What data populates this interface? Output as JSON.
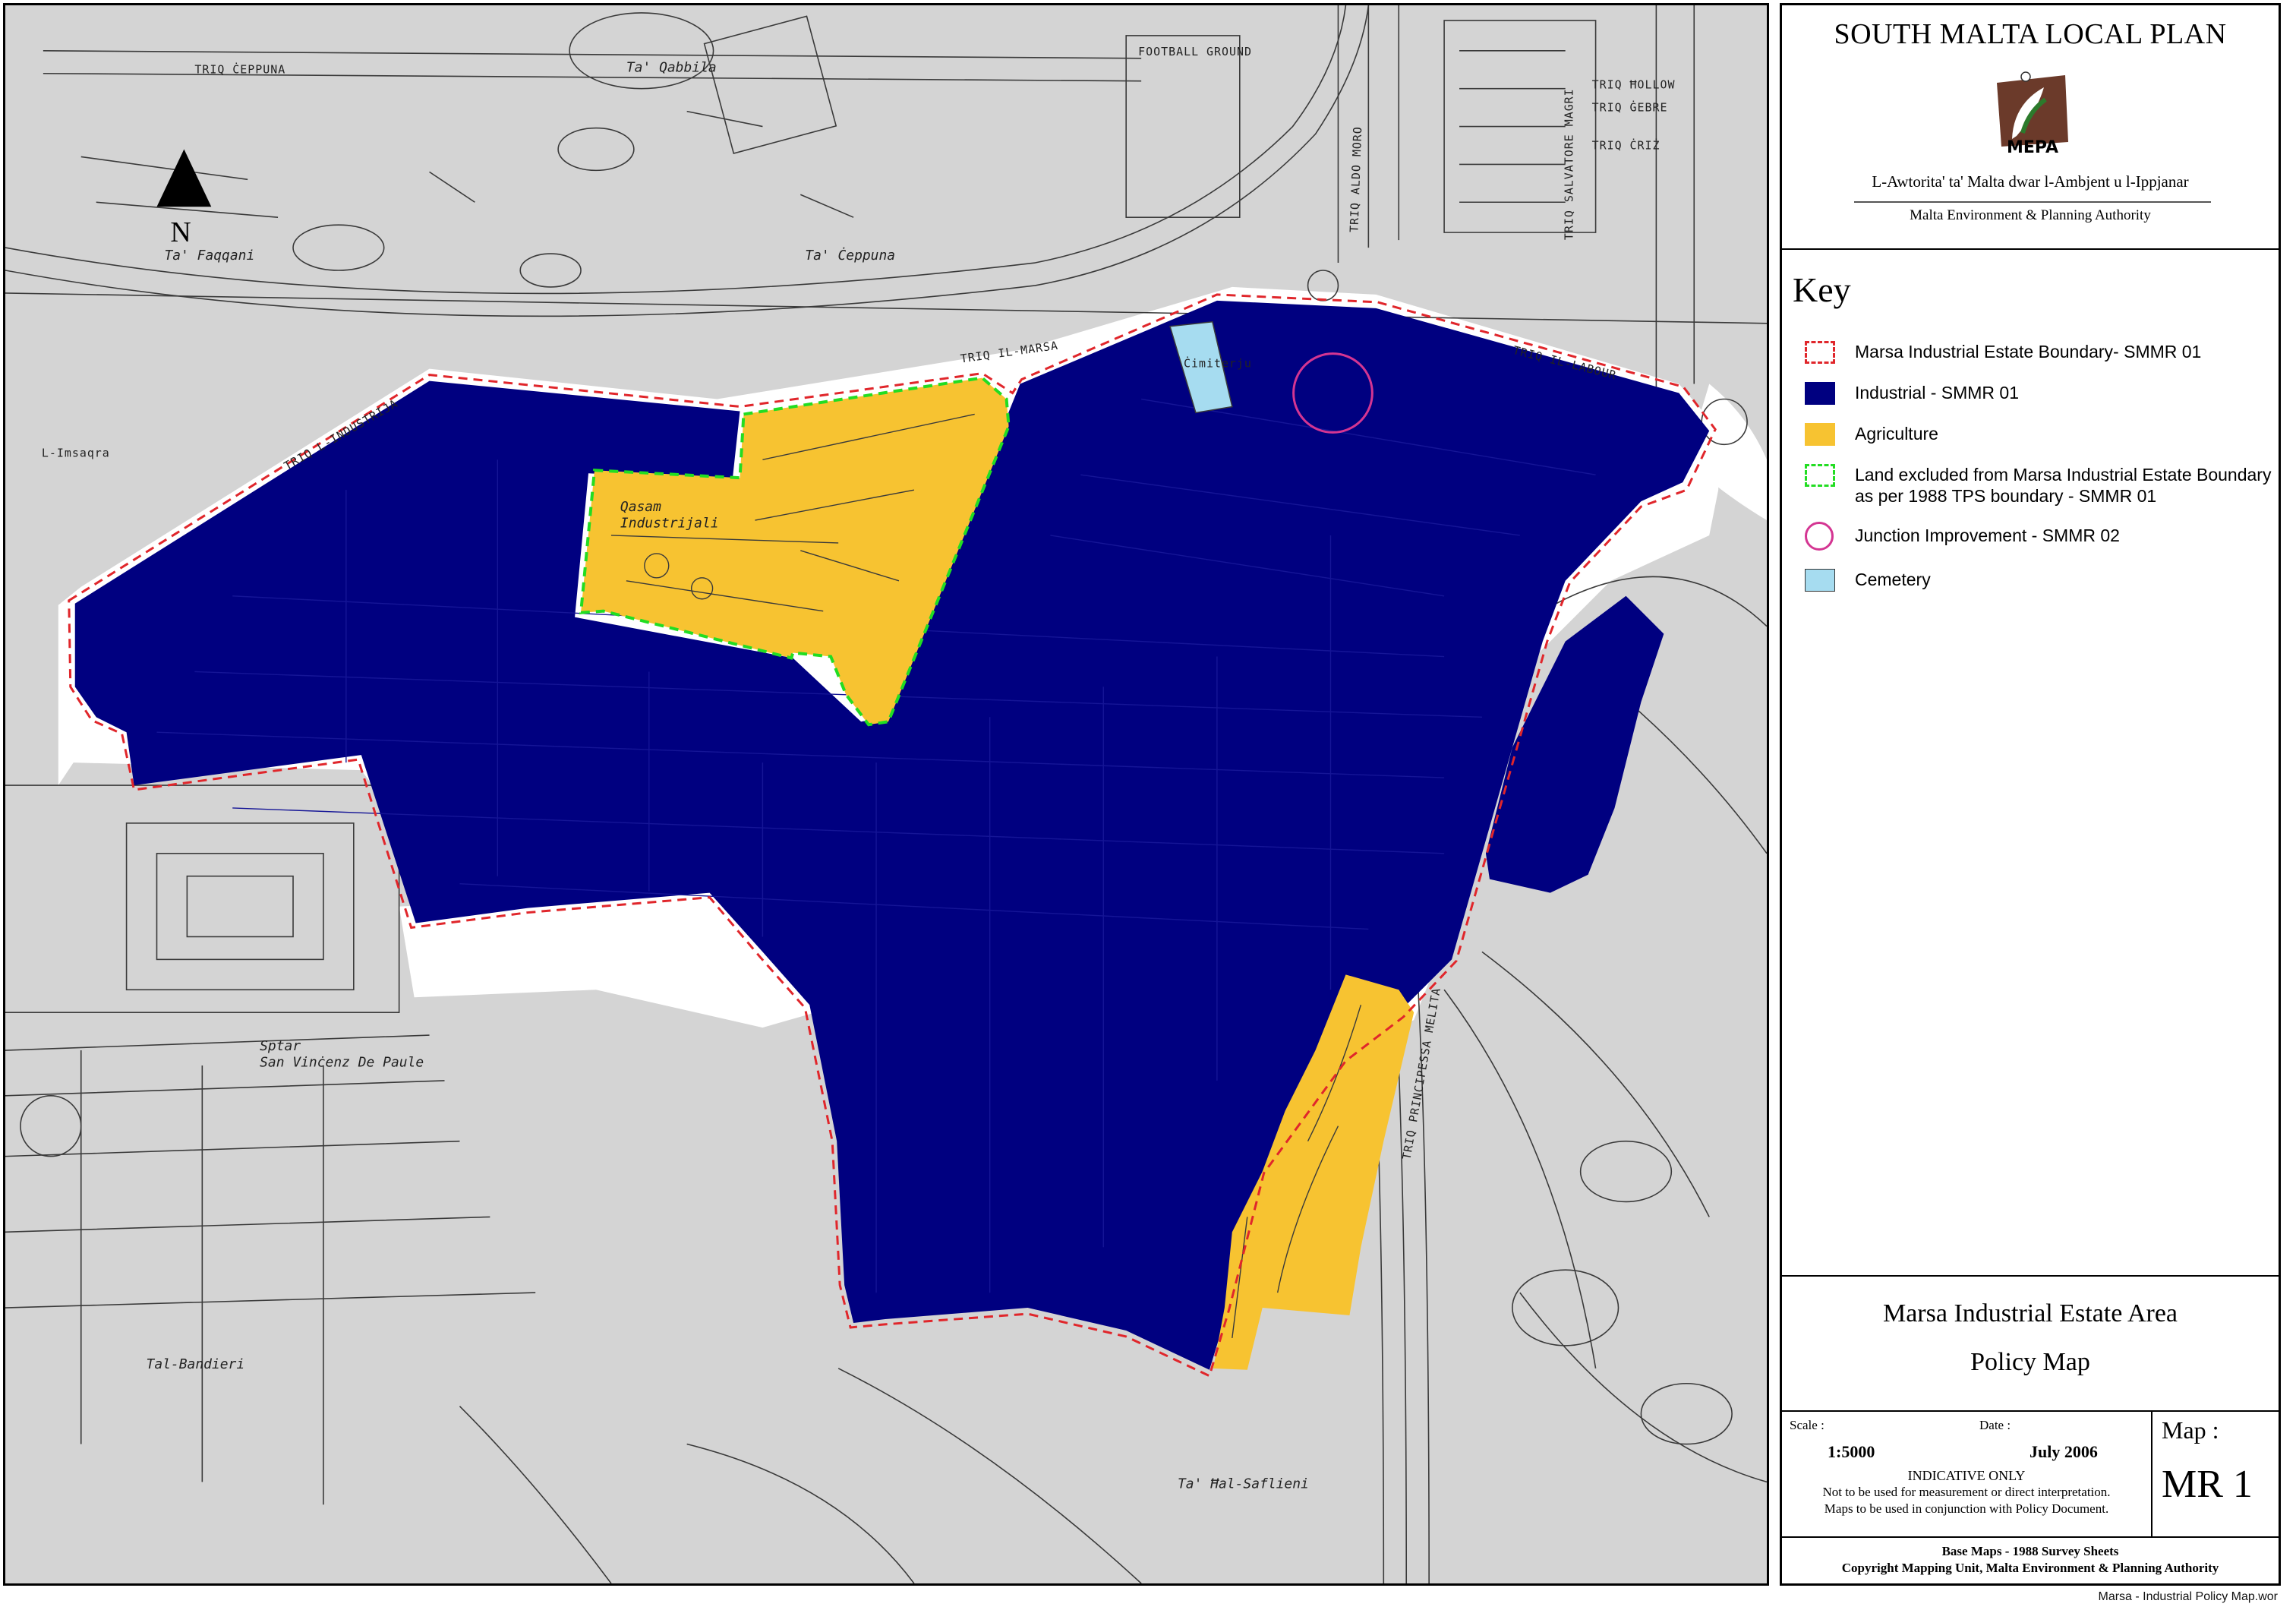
{
  "map": {
    "north_label": "N",
    "streets": [
      "TRIQ IL-MARSA",
      "TRIQ L-INDUSTRIJA",
      "TRIQ IL-LABOUR",
      "TRIQ ALDO MORO",
      "TRIQ PRINCIPESSA MELITA",
      "TRIQ ĊEPPUNA",
      "TRIQ SALVATORE MAGRI",
      "TRIQ ĠEBRE",
      "TRIQ ĊRIŻ",
      "TRIQ ĦOLLOW"
    ],
    "places": [
      "Ta' Qabbila",
      "Ta' Faqqani",
      "Ta' Ċeppuna",
      "Qasam\nIndustrijali",
      "Sptar\nSan Vinċenz De Paule",
      "Tal-Bandieri",
      "Ta' Ħal-Saflieni",
      "L-Imsaqra",
      "Ċimiterju",
      "FOOTBALL GROUND"
    ],
    "colors": {
      "background": "#d4d4d4",
      "industrial": "#000080",
      "agriculture": "#f7c331",
      "cemetery": "#a6dcf0",
      "boundary": "#e0262b",
      "excluded": "#22dd22",
      "junction": "#d43592",
      "lines": "#3a3a3a"
    }
  },
  "panel": {
    "plan_title": "SOUTH MALTA LOCAL PLAN",
    "logo_text": "MEPA",
    "authority_mt": "L-Awtorita' ta' Malta dwar l-Ambjent u l-Ippjanar",
    "authority_en": "Malta Environment & Planning Authority",
    "key_title": "Key",
    "key_items": [
      {
        "label": "Marsa Industrial Estate Boundary- SMMR 01",
        "swatch": "boundary-dashed-red"
      },
      {
        "label": "Industrial - SMMR 01",
        "swatch": "fill-navy"
      },
      {
        "label": "Agriculture",
        "swatch": "fill-yellow"
      },
      {
        "label": "Land excluded from Marsa Industrial Estate Boundary\nas per 1988 TPS boundary - SMMR 01",
        "swatch": "boundary-dashed-green"
      },
      {
        "label": "Junction Improvement - SMMR 02",
        "swatch": "circle-magenta"
      },
      {
        "label": "Cemetery",
        "swatch": "fill-lightblue"
      }
    ],
    "map_title_1": "Marsa Industrial Estate Area",
    "map_title_2": "Policy Map",
    "scale_caption": "Scale :",
    "scale_value": "1:5000",
    "date_caption": "Date :",
    "date_value": "July 2006",
    "indicative": "INDICATIVE ONLY",
    "disclaimer_1": "Not to be used for measurement or direct interpretation.",
    "disclaimer_2": "Maps to be used in conjunction with Policy Document.",
    "map_caption": "Map :",
    "map_number": "MR 1",
    "base_maps": "Base Maps - 1988 Survey Sheets",
    "copyright": "Copyright Mapping Unit, Malta Environment & Planning Authority"
  },
  "file_name": "Marsa - Industrial Policy Map.wor"
}
